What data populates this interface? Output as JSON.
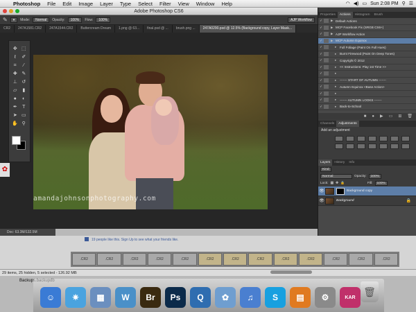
{
  "menubar": {
    "app": "Photoshop",
    "items": [
      "File",
      "Edit",
      "Image",
      "Layer",
      "Type",
      "Select",
      "Filter",
      "View",
      "Window",
      "Help"
    ],
    "clock": "Sun 2:08 PM"
  },
  "window": {
    "title": "Adobe Photoshop CS6"
  },
  "options_bar": {
    "mode_label": "Mode:",
    "mode_value": "Normal",
    "opacity_label": "Opacity:",
    "opacity_value": "100%",
    "flow_label": "Flow:",
    "flow_value": "100%",
    "workspace": "AJP Workflow"
  },
  "doc_tabs": [
    {
      "label": "CR2"
    },
    {
      "label": "247A1581.CR2"
    },
    {
      "label": "247A1544.CR2"
    },
    {
      "label": "Buttercream Dream"
    },
    {
      "label": "1.png @ 63..."
    },
    {
      "label": "final.psd @ ..."
    },
    {
      "label": "brush.png ..."
    },
    {
      "label": "247A0290.psd @ 12.5% (Background copy, Layer Mask..."
    }
  ],
  "canvas": {
    "watermark": "amandajohnsonphotography.com"
  },
  "status": {
    "doc_info": "Doc: 63.3M/132.5M"
  },
  "actions_panel": {
    "tabs": [
      "Properties",
      "Actions",
      "Histogram",
      "Brush"
    ],
    "rows": [
      {
        "label": "Default Actions",
        "kind": "set",
        "selected": false
      },
      {
        "label": "MCP Facebook Fix (SRGB CS6+)",
        "kind": "set",
        "selected": false
      },
      {
        "label": "AJP Workflow Action",
        "kind": "set",
        "selected": false
      },
      {
        "label": "MCP Autumn Equinox",
        "kind": "set",
        "selected": true
      },
      {
        "label": "Full Foliage (Paint On Full Hues)",
        "kind": "action",
        "selected": false
      },
      {
        "label": "Burnt Firewood (Paint On Deep Tones)",
        "kind": "action",
        "selected": false
      },
      {
        "label": "Copyright © 2012",
        "kind": "action",
        "selected": false
      },
      {
        "label": "<< Instructions: Play 1st Time >>",
        "kind": "action",
        "selected": false
      },
      {
        "label": "",
        "kind": "action",
        "selected": false
      },
      {
        "label": "------- START OF AUTUMN -------",
        "kind": "action",
        "selected": false
      },
      {
        "label": "Autumn Equinox <Base Action>",
        "kind": "action",
        "selected": false
      },
      {
        "label": "",
        "kind": "action",
        "selected": false
      },
      {
        "label": "------- AUTUMN LOOKS -------",
        "kind": "action",
        "selected": false
      },
      {
        "label": "Back-to-School",
        "kind": "action",
        "selected": false
      }
    ]
  },
  "adjustments_panel": {
    "tabs": [
      "Channels",
      "Adjustments"
    ],
    "title": "Add an adjustment"
  },
  "layers_panel": {
    "tabs": [
      "Layers",
      "History",
      "Info"
    ],
    "kind_label": "Kind",
    "blend_mode": "Normal",
    "opacity_label": "Opacity:",
    "opacity_value": "100%",
    "lock_label": "Lock:",
    "fill_label": "Fill:",
    "fill_value": "100%",
    "layers": [
      {
        "name": "Background copy",
        "has_mask": true,
        "selected": true
      },
      {
        "name": "Background",
        "has_mask": false,
        "selected": false
      }
    ]
  },
  "behind_window": {
    "facebook_text": "19 people like this. Sign Up to see what your friends like.",
    "film_labels": [
      ".CR2",
      ".CR2",
      ".CR2",
      ".CR2",
      ".CR2",
      ".CR2",
      ".CR2",
      ".CR2",
      ".CR2",
      ".CR2",
      ".CR2",
      ".CR2",
      ".CR2"
    ],
    "path_status": "29 items, 25 hidden, 5 selected - 126.92 MB"
  },
  "desktop": {
    "file_label": "Backups.backupdb"
  },
  "dock": {
    "apps": [
      {
        "icon": "finder-icon",
        "glyph": "☺",
        "color": "#3a7bd5"
      },
      {
        "icon": "safari-icon",
        "glyph": "✷",
        "color": "#4aa3df"
      },
      {
        "icon": "preview-icon",
        "glyph": "▦",
        "color": "#6b8fbf"
      },
      {
        "icon": "wordpress-icon",
        "glyph": "W",
        "color": "#4a90c8"
      },
      {
        "icon": "bridge-icon",
        "glyph": "Br",
        "color": "#3a2a10"
      },
      {
        "icon": "photoshop-icon",
        "glyph": "Ps",
        "color": "#0b2a4a"
      },
      {
        "icon": "quicktime-icon",
        "glyph": "Q",
        "color": "#2f6db0"
      },
      {
        "icon": "iphoto-icon",
        "glyph": "✿",
        "color": "#6f9ed0"
      },
      {
        "icon": "itunes-icon",
        "glyph": "♫",
        "color": "#4a7fd0"
      },
      {
        "icon": "skype-icon",
        "glyph": "S",
        "color": "#17a0e0"
      },
      {
        "icon": "ibooks-icon",
        "glyph": "▤",
        "color": "#e07a20"
      },
      {
        "icon": "preferences-icon",
        "glyph": "⚙",
        "color": "#8a8a8a"
      },
      {
        "icon": "karma-icon",
        "glyph": "KAR",
        "color": "#c0306a"
      }
    ]
  },
  "colors": {
    "ps_panel": "#3c3c3c",
    "selection_blue": "#5d7ea8",
    "ps_workspace": "#262626"
  }
}
